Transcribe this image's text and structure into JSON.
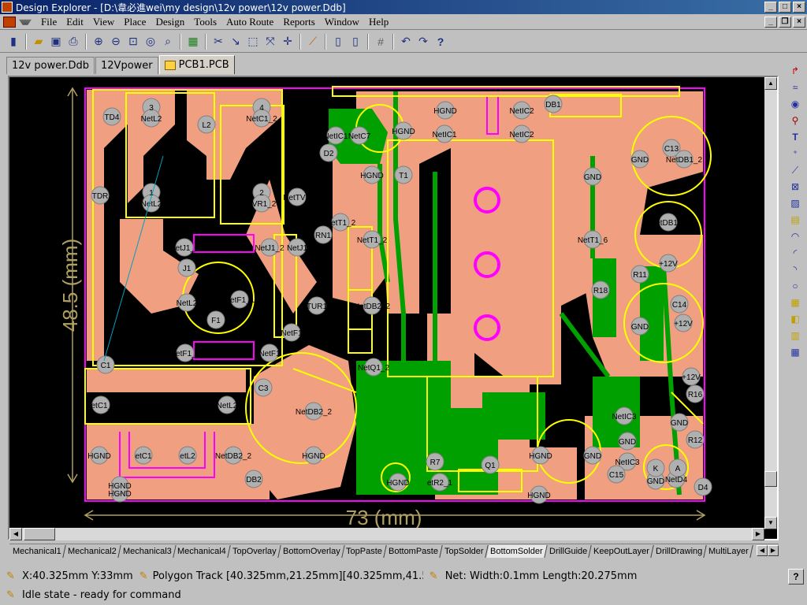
{
  "window": {
    "title": "Design Explorer - [D:\\韋必進wei\\my design\\12v power\\12v power.Ddb]"
  },
  "menu": {
    "items": [
      "File",
      "Edit",
      "View",
      "Place",
      "Design",
      "Tools",
      "Auto Route",
      "Reports",
      "Window",
      "Help"
    ]
  },
  "toolbar": {
    "icons": [
      "open-folder-icon",
      "save-icon",
      "print-icon",
      "zoom-in-icon",
      "zoom-out-icon",
      "zoom-area-icon",
      "zoom-fit-icon",
      "browse-icon",
      "cross-probe-icon",
      "cut-track-icon",
      "select-icon",
      "move-icon",
      "cross-icon",
      "route-icon",
      "library-icon",
      "library-browse-icon",
      "grid-icon",
      "undo-icon",
      "redo-icon",
      "help-icon"
    ]
  },
  "tabs": [
    {
      "label": "12v power.Ddb",
      "active": false
    },
    {
      "label": "12Vpower",
      "active": false
    },
    {
      "label": "PCB1.PCB",
      "active": true
    }
  ],
  "board": {
    "dim_width": "73 (mm)",
    "dim_height": "48.5 (mm)",
    "labels": [
      {
        "t": "3"
      },
      {
        "t": "NetL2"
      },
      {
        "t": "4"
      },
      {
        "t": "NetC1_2"
      },
      {
        "t": "L2"
      },
      {
        "t": "TD4"
      },
      {
        "t": "TDR"
      },
      {
        "t": "1"
      },
      {
        "t": "NetL2"
      },
      {
        "t": "2"
      },
      {
        "t": "TVR1_2"
      },
      {
        "t": "NetTVR"
      },
      {
        "t": "RN1"
      },
      {
        "t": "NetJ1_2"
      },
      {
        "t": "NetJ1_2"
      },
      {
        "t": "NetJ1"
      },
      {
        "t": "J1"
      },
      {
        "t": "NetL2"
      },
      {
        "t": "NetF1_1"
      },
      {
        "t": "F1"
      },
      {
        "t": "TUR1"
      },
      {
        "t": "NetF1"
      },
      {
        "t": "NetF1_1"
      },
      {
        "t": "NetF1"
      },
      {
        "t": "C1"
      },
      {
        "t": "NetC1_2"
      },
      {
        "t": "NetL2"
      },
      {
        "t": "C3"
      },
      {
        "t": "NetDB2_2"
      },
      {
        "t": "HGND"
      },
      {
        "t": "etC1"
      },
      {
        "t": "etL2"
      },
      {
        "t": "NetDB2_2"
      },
      {
        "t": "HGND"
      },
      {
        "t": "HGND"
      },
      {
        "t": "DB2"
      },
      {
        "t": "HGND"
      },
      {
        "t": "NetIC1"
      },
      {
        "t": "NetC7"
      },
      {
        "t": "HGND"
      },
      {
        "t": "D2"
      },
      {
        "t": "HGND"
      },
      {
        "t": "T1"
      },
      {
        "t": "NetT1_2"
      },
      {
        "t": "NetT1_2"
      },
      {
        "t": "NetDB2_2"
      },
      {
        "t": "NetQ1_2"
      },
      {
        "t": "HGND"
      },
      {
        "t": "etR2_1"
      },
      {
        "t": "R7"
      },
      {
        "t": "Q1"
      },
      {
        "t": "HGND"
      },
      {
        "t": "NetIC1"
      },
      {
        "t": "HGND"
      },
      {
        "t": "NetIC2"
      },
      {
        "t": "NetIC2"
      },
      {
        "t": "DB1"
      },
      {
        "t": "GND"
      },
      {
        "t": "C13"
      },
      {
        "t": "NetDB1_2"
      },
      {
        "t": "GND"
      },
      {
        "t": "NetT1_6"
      },
      {
        "t": "NetDB1_2"
      },
      {
        "t": "+12V"
      },
      {
        "t": "R18"
      },
      {
        "t": "C14"
      },
      {
        "t": "GND"
      },
      {
        "t": "+12V"
      },
      {
        "t": "+12V"
      },
      {
        "t": "R16"
      },
      {
        "t": "GND"
      },
      {
        "t": "NetIC3"
      },
      {
        "t": "GND"
      },
      {
        "t": "NetIC3"
      },
      {
        "t": "C15"
      },
      {
        "t": "HGND"
      },
      {
        "t": "GND"
      },
      {
        "t": "GND"
      },
      {
        "t": "NetD4"
      },
      {
        "t": "D4"
      },
      {
        "t": "K"
      },
      {
        "t": "A"
      },
      {
        "t": "R11"
      },
      {
        "t": "R12"
      }
    ]
  },
  "layers": [
    "Mechanical1",
    "Mechanical2",
    "Mechanical3",
    "Mechanical4",
    "TopOverlay",
    "BottomOverlay",
    "TopPaste",
    "BottomPaste",
    "TopSolder",
    "BottomSolder",
    "DrillGuide",
    "KeepOutLayer",
    "DrillDrawing",
    "MultiLayer"
  ],
  "active_layer": "BottomSolder",
  "status": {
    "coords": "X:40.325mm Y:33mm",
    "object": "Polygon Track [40.325mm,21.25mm][40.325mm,41.525",
    "net": "Net: Width:0.1mm Length:20.275mm",
    "state": "Idle state - ready for command"
  },
  "colors": {
    "copper_bottom": "#f0a080",
    "copper_top": "#00a000",
    "overlay": "#ffff00",
    "keepout": "#ff00ff",
    "pad": "#b0b0b0",
    "board_bg": "#000000"
  }
}
